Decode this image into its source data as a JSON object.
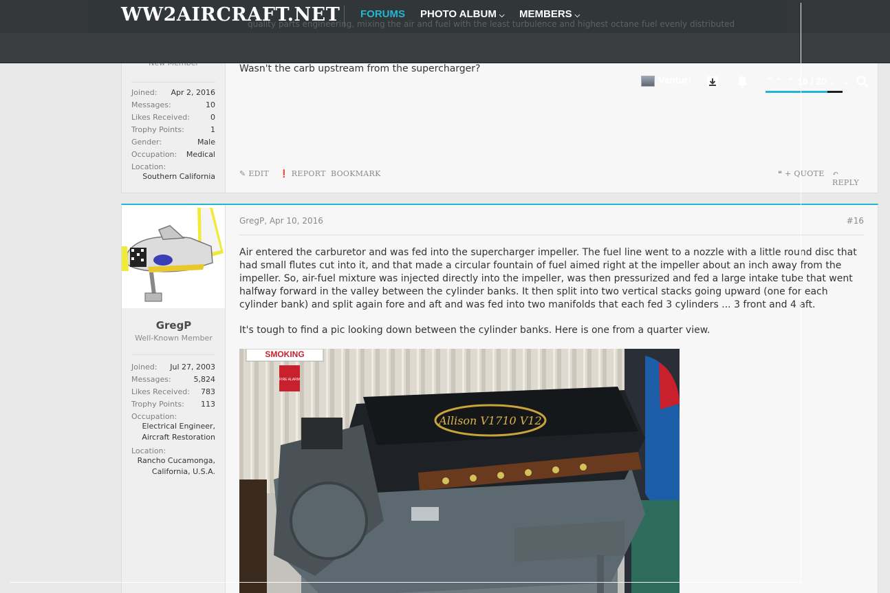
{
  "header": {
    "logo": "WW2AIRCRAFT.NET",
    "nav": [
      {
        "label": "FORUMS",
        "active": true
      },
      {
        "label": "PHOTO ALBUM",
        "active": false
      },
      {
        "label": "MEMBERS",
        "active": false
      }
    ],
    "user": "Venturi",
    "pager": {
      "current": "16",
      "total": "20",
      "progress": 0.8
    }
  },
  "post1": {
    "role": "New Member",
    "stats": [
      {
        "label": "Joined:",
        "value": "Apr 2, 2016"
      },
      {
        "label": "Messages:",
        "value": "10"
      },
      {
        "label": "Likes Received:",
        "value": "0"
      },
      {
        "label": "Trophy Points:",
        "value": "1"
      },
      {
        "label": "Gender:",
        "value": "Male"
      },
      {
        "label": "Occupation:",
        "value": "Medical"
      }
    ],
    "location_label": "Location:",
    "location_value": "Southern California",
    "message": "Wasn't the carb upstream from the supercharger?",
    "actions": {
      "edit": "EDIT",
      "report": "REPORT",
      "bookmark": "BOOKMARK",
      "quote": "+ QUOTE",
      "reply": "REPLY"
    }
  },
  "post2": {
    "username": "GregP",
    "role": "Well-Known Member",
    "stats": [
      {
        "label": "Joined:",
        "value": "Jul 27, 2003"
      },
      {
        "label": "Messages:",
        "value": "5,824"
      },
      {
        "label": "Likes Received:",
        "value": "783"
      },
      {
        "label": "Trophy Points:",
        "value": "113"
      }
    ],
    "occupation_label": "Occupation:",
    "occupation_lines": [
      "Electrical Engineer,",
      "Aircraft Restoration"
    ],
    "location_label": "Location:",
    "location_lines": [
      "Rancho Cucamonga,",
      "California, U.S.A."
    ],
    "meta": "GregP, Apr 10, 2016",
    "number": "#16",
    "paragraph1": "Air entered the carburetor and was fed into the supercharger impeller. The fuel line went to a nozzle with a little round disc that had small flutes cut into it, and that made a circular fountain of fuel aimed right at the impeller about an inch away from the impeller. So, air-fuel mixture was injected directly into the impeller, was then pressurized and fed a large intake tube that went halfway forward in the valley between the cylinder banks. It then split into two vertical stacks going upward (one for each cylinder bank) and split again fore and aft and was fed into two manifolds that each fed 3 cylinders ... 3 front and 4 aft.",
    "paragraph2": "It's tough to find a pic looking down between the cylinder banks. Here is one from a quarter view.",
    "image_sign": "SMOKING",
    "image_fire": "FIRE ALARM",
    "image_badge": "Allison V1710 V12"
  },
  "colors": {
    "accent": "#1fb5d3",
    "header": "#2c3133",
    "subheader": "#3a3d3f"
  }
}
